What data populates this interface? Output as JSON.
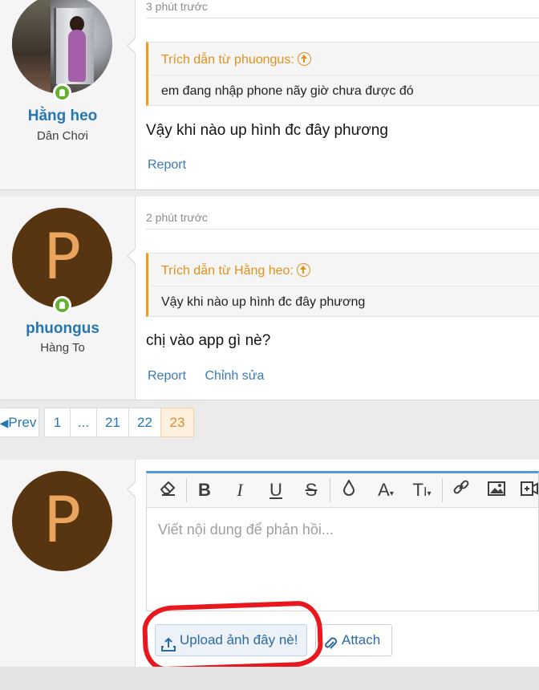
{
  "posts": [
    {
      "user": {
        "name": "Hằng heo",
        "title": "Dân Chơi",
        "avatar": "photo-avatar",
        "online": true
      },
      "time": "3 phút trước",
      "quote": {
        "header": "Trích dẫn từ phuongus:",
        "text": "em đang nhập phone nãy giờ chưa được đó"
      },
      "message": "Vậy khi nào up hình đc đây phương",
      "actions": [
        "Report"
      ]
    },
    {
      "user": {
        "name": "phuongus",
        "title": "Hàng To",
        "avatar_letter": "P",
        "online": true
      },
      "time": "2 phút trước",
      "quote": {
        "header": "Trích dẫn từ Hằng heo:",
        "text": "Vậy khi nào up hình đc đây phương"
      },
      "message": "chị vào app gì nè?",
      "actions": [
        "Report",
        "Chỉnh sửa"
      ]
    }
  ],
  "pagination": {
    "prev": "Prev",
    "pages": [
      "1",
      "...",
      "21",
      "22",
      "23"
    ],
    "current": "23"
  },
  "reply": {
    "avatar_letter": "P",
    "placeholder": "Viết nội dung để phản hồi...",
    "toolbar": [
      "eraser-icon",
      "bold-icon",
      "italic-icon",
      "underline-icon",
      "strikethrough-icon",
      "color-drop-icon",
      "font-color-icon",
      "text-size-icon",
      "link-icon",
      "image-icon",
      "media-icon"
    ],
    "upload_label": "Upload ảnh đây nè!",
    "attach_label": "Attach"
  },
  "colors": {
    "link": "#2577b1",
    "quote_accent": "#f39c12",
    "avatar_bg": "#573510",
    "avatar_letter": "#eaa45e",
    "online": "#63b32e",
    "annotation": "#e8181e"
  }
}
